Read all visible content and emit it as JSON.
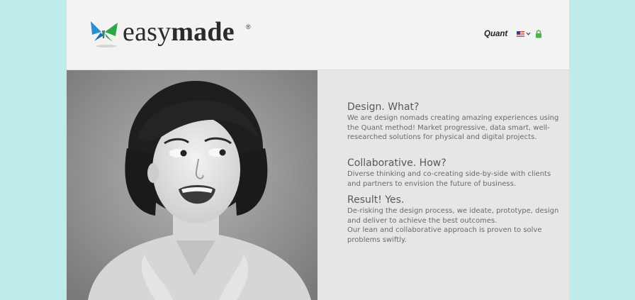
{
  "brand": {
    "logo_easy": "easy",
    "logo_made": "made",
    "registered_mark": "®",
    "colors": {
      "wing_blue": "#2a8fd0",
      "wing_green": "#2aa84a",
      "accent_lock": "#4caf50"
    }
  },
  "header": {
    "nav_link": "Quant",
    "language_icon": "us-flag-icon",
    "lock_icon": "lock-icon"
  },
  "hero": {
    "photo_icon": "woman-portrait-photo"
  },
  "sections": [
    {
      "heading": "Design. What?",
      "paragraphs": [
        "We are design nomads creating amazing experiences using the Quant method! Market progressive, data smart, well-researched solutions for physical and digital projects."
      ]
    },
    {
      "heading": "Collaborative. How?",
      "paragraphs": [
        "Diverse thinking and co-creating side-by-side with clients and partners to envision the future of business."
      ]
    },
    {
      "heading": "Result! Yes.",
      "paragraphs": [
        "De-risking the design process, we ideate, prototype, design and deliver to achieve the best outcomes.",
        "Our lean and collaborative approach is proven to solve problems swiftly."
      ]
    }
  ]
}
